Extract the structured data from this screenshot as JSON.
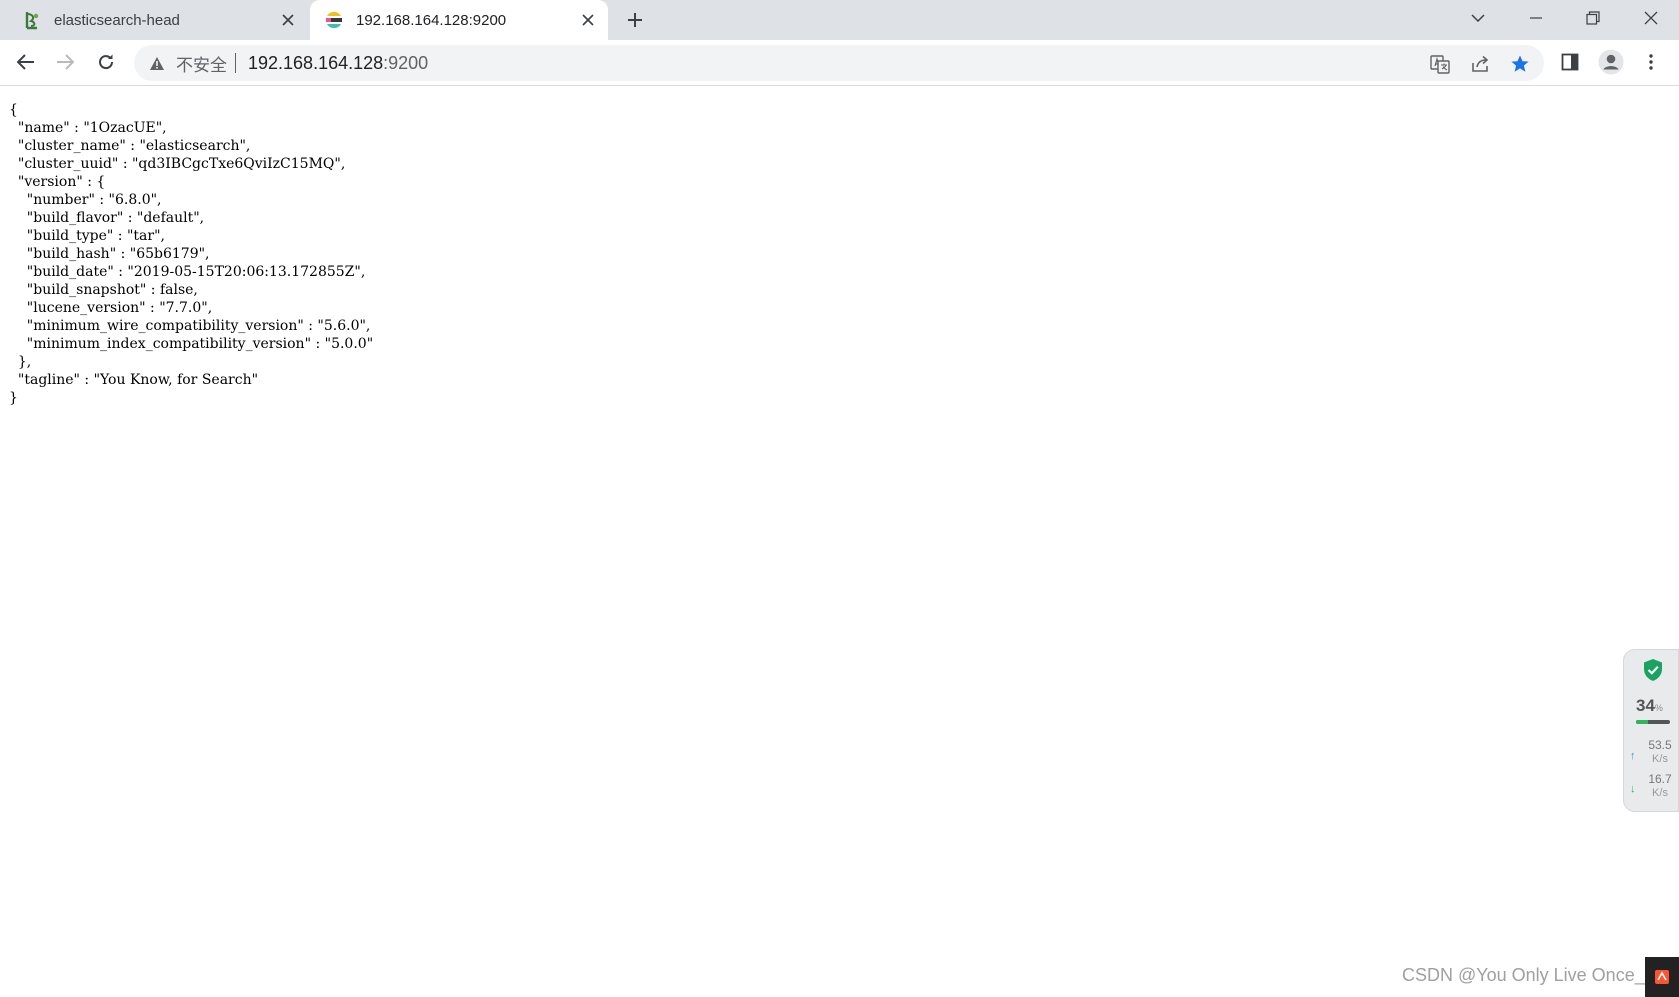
{
  "tabs": [
    {
      "title": "elasticsearch-head",
      "favicon": "elasticsearch-head-icon",
      "active": false
    },
    {
      "title": "192.168.164.128:9200",
      "favicon": "elastic-logo-icon",
      "active": true
    }
  ],
  "toolbar": {
    "security_label": "不安全",
    "url_host": "192.168.164.128",
    "url_port": ":9200"
  },
  "json_response": {
    "text": "{\n  \"name\" : \"1OzacUE\",\n  \"cluster_name\" : \"elasticsearch\",\n  \"cluster_uuid\" : \"qd3IBCgcTxe6QviIzC15MQ\",\n  \"version\" : {\n    \"number\" : \"6.8.0\",\n    \"build_flavor\" : \"default\",\n    \"build_type\" : \"tar\",\n    \"build_hash\" : \"65b6179\",\n    \"build_date\" : \"2019-05-15T20:06:13.172855Z\",\n    \"build_snapshot\" : false,\n    \"lucene_version\" : \"7.7.0\",\n    \"minimum_wire_compatibility_version\" : \"5.6.0\",\n    \"minimum_index_compatibility_version\" : \"5.0.0\"\n  },\n  \"tagline\" : \"You Know, for Search\"\n}"
  },
  "monitor_widget": {
    "usage_percent": "34",
    "usage_symbol": "%",
    "usage_fraction": 0.34,
    "upload_rate": "53.5",
    "upload_unit": "K/s",
    "download_rate": "16.7",
    "download_unit": "K/s",
    "colors": {
      "shield": "#1aa260",
      "bar": "#2fb55b",
      "up": "#3a8ee6",
      "down": "#2fb55b"
    }
  },
  "watermark": "CSDN @You Only Live Once_2",
  "colors": {
    "tabstrip": "#dee1e6",
    "omnibox": "#f1f3f4",
    "star": "#1a73e8"
  }
}
